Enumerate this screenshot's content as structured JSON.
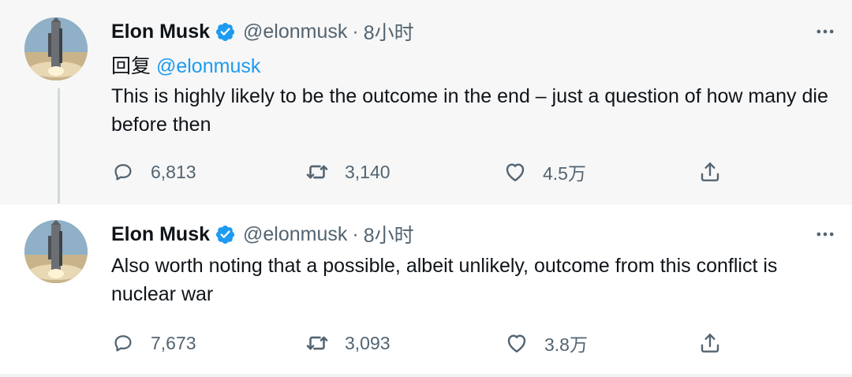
{
  "tweets": [
    {
      "author_name": "Elon Musk",
      "handle": "@elonmusk",
      "separator": "·",
      "time": "8小时",
      "reply_prefix": "回复",
      "reply_mention": "@elonmusk",
      "text": "This is highly likely to be the outcome in the end – just a question of how many die before then",
      "replies": "6,813",
      "retweets": "3,140",
      "likes": "4.5万",
      "icons": {
        "avatar": "rocket-launch-avatar",
        "verified": "verified-badge-icon",
        "more": "more-options-icon",
        "reply": "reply-icon",
        "retweet": "retweet-icon",
        "like": "heart-icon",
        "share": "share-icon"
      }
    },
    {
      "author_name": "Elon Musk",
      "handle": "@elonmusk",
      "separator": "·",
      "time": "8小时",
      "text": "Also worth noting that a possible, albeit unlikely, outcome from this conflict is nuclear war",
      "replies": "7,673",
      "retweets": "3,093",
      "likes": "3.8万"
    }
  ],
  "colors": {
    "accent": "#1d9bf0",
    "secondary_text": "#536471",
    "primary_text": "#0f1419",
    "highlighted_background": "#f7f7f7"
  }
}
